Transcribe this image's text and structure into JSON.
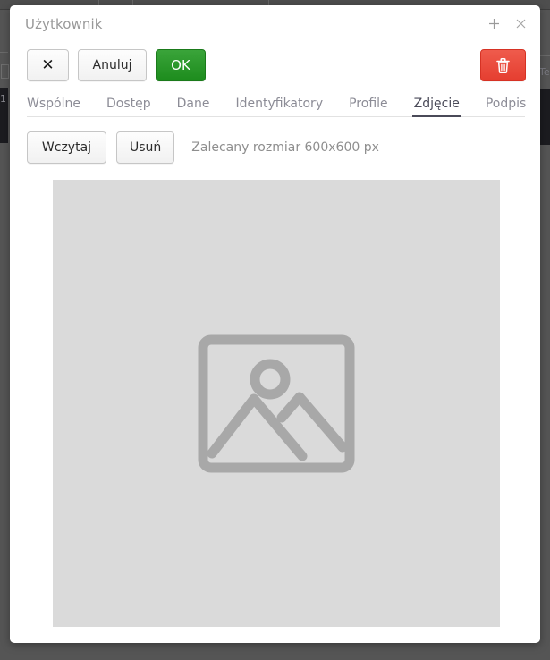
{
  "window": {
    "title": "Użytkownik",
    "titlebar_icons": [
      {
        "name": "add-icon",
        "glyph": "+"
      },
      {
        "name": "close-icon",
        "glyph": "×"
      }
    ]
  },
  "toolbar": {
    "close_label": "✕",
    "cancel_label": "Anuluj",
    "ok_label": "OK",
    "delete_icon": "trash-icon",
    "ok_color": "#2a952a",
    "delete_color": "#e84030"
  },
  "tabs": {
    "items": [
      {
        "label": "Wspólne",
        "active": false
      },
      {
        "label": "Dostęp",
        "active": false
      },
      {
        "label": "Dane",
        "active": false
      },
      {
        "label": "Identyfikatory",
        "active": false
      },
      {
        "label": "Profile",
        "active": false
      },
      {
        "label": "Zdjęcie",
        "active": true
      },
      {
        "label": "Podpis",
        "active": false
      }
    ],
    "active_index": 5,
    "active_color": "#4a4a58",
    "inactive_color": "#8c8c96"
  },
  "photo_tab": {
    "load_label": "Wczytaj",
    "remove_label": "Usuń",
    "hint": "Zalecany rozmiar 600x600 px",
    "placeholder_icon": "image-placeholder-icon",
    "placeholder_bg": "#dadada",
    "placeholder_icon_color": "#a8a8a8"
  },
  "background": {
    "row_number": "1",
    "right_label": "Te",
    "surface_color": "#555555"
  }
}
